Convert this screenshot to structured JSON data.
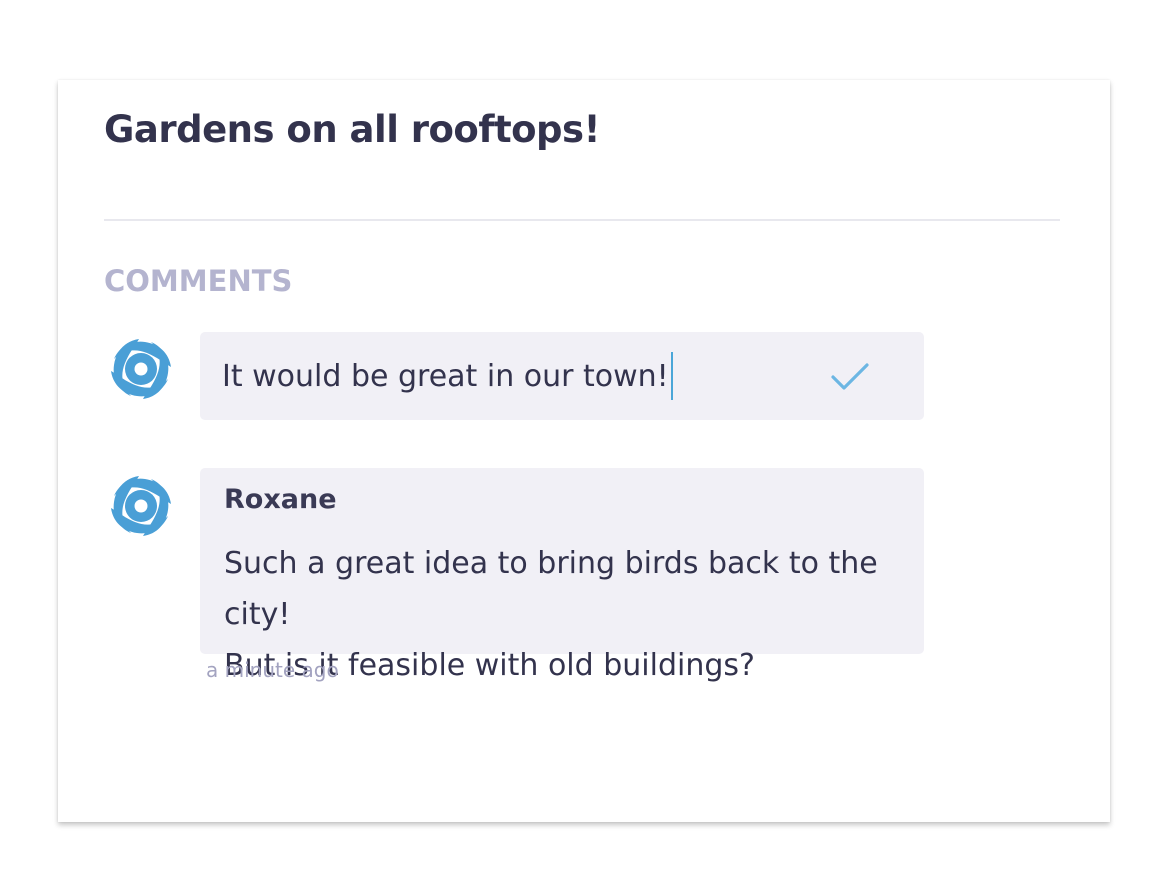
{
  "post": {
    "title": "Gardens on all rooftops!"
  },
  "comments_section": {
    "label": "COMMENTS",
    "new_comment": {
      "value": "It would be great in our town!",
      "avatar_icon": "hurricane-icon",
      "submit_icon": "check-icon"
    },
    "items": [
      {
        "author": "Roxane",
        "lines": [
          "Such a great idea to bring birds back to the city!",
          "But is it feasible with old buildings?"
        ],
        "time": "a minute ago",
        "avatar_icon": "hurricane-icon"
      }
    ]
  },
  "colors": {
    "title": "#33334d",
    "section_label": "#b4b4cf",
    "bubble_bg": "#f1f0f6",
    "accent": "#4a9fd6",
    "check": "#6cb6e3",
    "timestamp": "#a3a3c0"
  }
}
